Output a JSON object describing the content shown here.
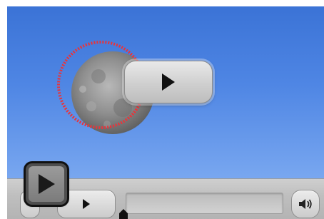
{
  "player": {
    "progress_fraction": 0.0,
    "colors": {
      "sky_top": "#3b73d6",
      "sky_bottom": "#7aa8f0",
      "highlight_ring": "#e8343b",
      "control_bar": "#c4c4c4"
    },
    "icons": {
      "big_play": "play-icon",
      "bar_play": "play-icon",
      "volume": "speaker-icon",
      "overlay_play": "play-icon",
      "scrubber": "playhead-icon"
    }
  }
}
